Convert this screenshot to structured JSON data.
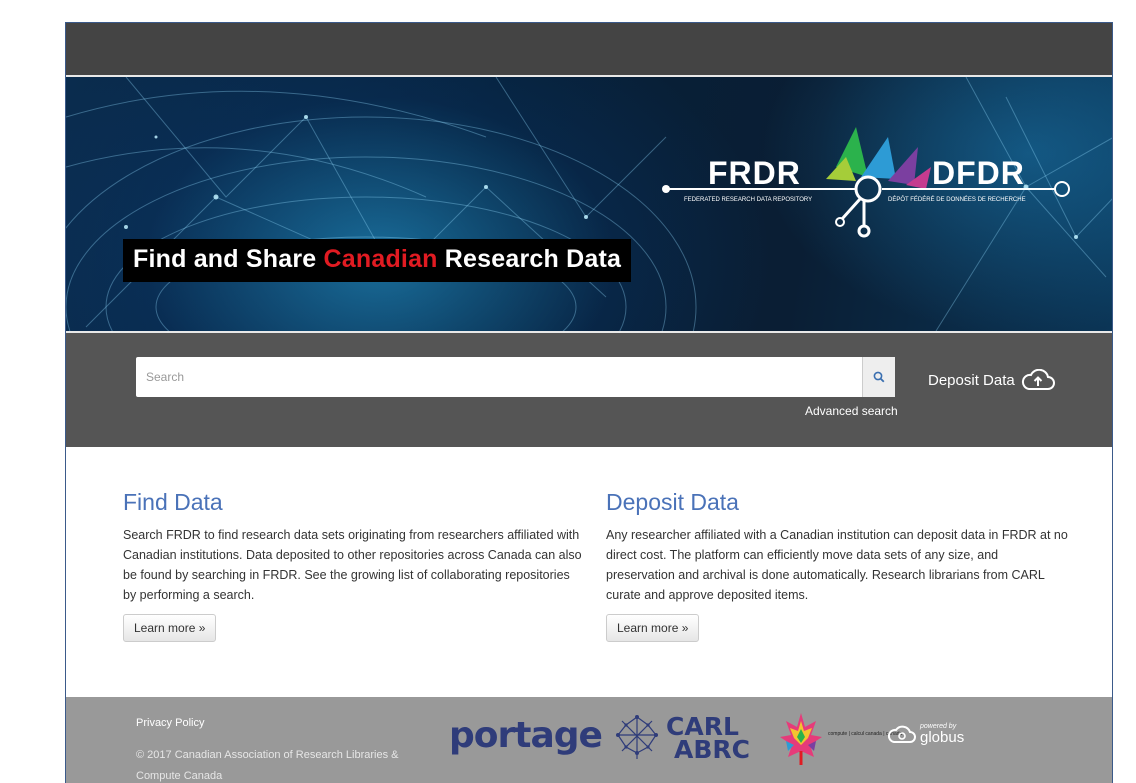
{
  "hero": {
    "title_part1": "Find and Share ",
    "title_highlight": "Canadian",
    "title_part2": " Research Data",
    "logo_left": "FRDR",
    "logo_right": "DFDR",
    "logo_sub_en": "FEDERATED RESEARCH DATA REPOSITORY",
    "logo_sub_fr": "DÉPÔT FÉDÉRÉ DE DONNÉES DE RECHERCHE"
  },
  "search": {
    "placeholder": "Search",
    "advanced_label": "Advanced search",
    "deposit_label": "Deposit Data",
    "button_icon": "search-icon",
    "deposit_icon": "cloud-upload-icon"
  },
  "find": {
    "heading": "Find Data",
    "body": "Search FRDR to find research data sets originating from researchers affiliated with Canadian institutions. Data deposited to other repositories across Canada can also be found by searching in FRDR. See the growing list of collaborating repositories by performing a search.",
    "button": "Learn more »"
  },
  "deposit": {
    "heading": "Deposit Data",
    "body": "Any researcher affiliated with a Canadian institution can deposit data in FRDR at no direct cost. The platform can efficiently move data sets of any size, and preservation and archival is done automatically. Research librarians from CARL curate and approve deposited items.",
    "button": "Learn more »"
  },
  "footer": {
    "privacy": "Privacy Policy",
    "copyright": "© 2017 Canadian Association of Research Libraries & Compute Canada",
    "portage": "portage",
    "carl": "CARL",
    "abrc": "ABRC",
    "compute_canada": "compute | calcul canada | canada",
    "globus_powered": "powered by",
    "globus": "globus"
  },
  "colors": {
    "topbar": "#444444",
    "search_band": "#555555",
    "footer": "#999999",
    "heading_blue": "#4a72b8",
    "highlight_red": "#e11b22",
    "logo_navy": "#2f3c7a"
  }
}
